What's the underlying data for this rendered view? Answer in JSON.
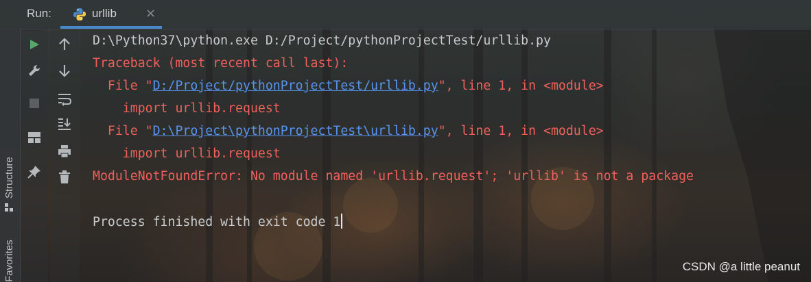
{
  "header": {
    "run_label": "Run:",
    "tab_title": "urllib",
    "tab_close": "×"
  },
  "side_stripe": {
    "structure_label": "Structure",
    "favorites_label": "Favorites"
  },
  "toolbar": {
    "left": [
      {
        "icon": "run-icon",
        "color": "#59a869"
      },
      {
        "icon": "wrench-icon"
      },
      {
        "icon": "stop-icon"
      },
      {
        "icon": "layout-icon"
      },
      {
        "icon": "pin-icon"
      }
    ],
    "right": [
      {
        "icon": "arrow-up-icon"
      },
      {
        "icon": "arrow-down-icon"
      },
      {
        "icon": "soft-wrap-icon"
      },
      {
        "icon": "scroll-to-end-icon"
      },
      {
        "icon": "print-icon"
      },
      {
        "icon": "trash-icon"
      }
    ]
  },
  "console": {
    "line1": "D:\\Python37\\python.exe D:/Project/pythonProjectTest/urllib.py",
    "line2": "Traceback (most recent call last):",
    "line3_pre": "  File \"",
    "line3_link": "D:/Project/pythonProjectTest/urllib.py",
    "line3_post": "\", line 1, in <module>",
    "line4": "    import urllib.request",
    "line5_pre": "  File \"",
    "line5_link": "D:\\Project\\pythonProjectTest\\urllib.py",
    "line5_post": "\", line 1, in <module>",
    "line6": "    import urllib.request",
    "line7": "ModuleNotFoundError: No module named 'urllib.request'; 'urllib' is not a package",
    "line9": "Process finished with exit code 1"
  },
  "colors": {
    "normal_text": "#c9ccce",
    "error_text": "#f2605c",
    "link_text": "#5894ef",
    "accent": "#4a88c7"
  },
  "watermark": "CSDN @a little peanut"
}
